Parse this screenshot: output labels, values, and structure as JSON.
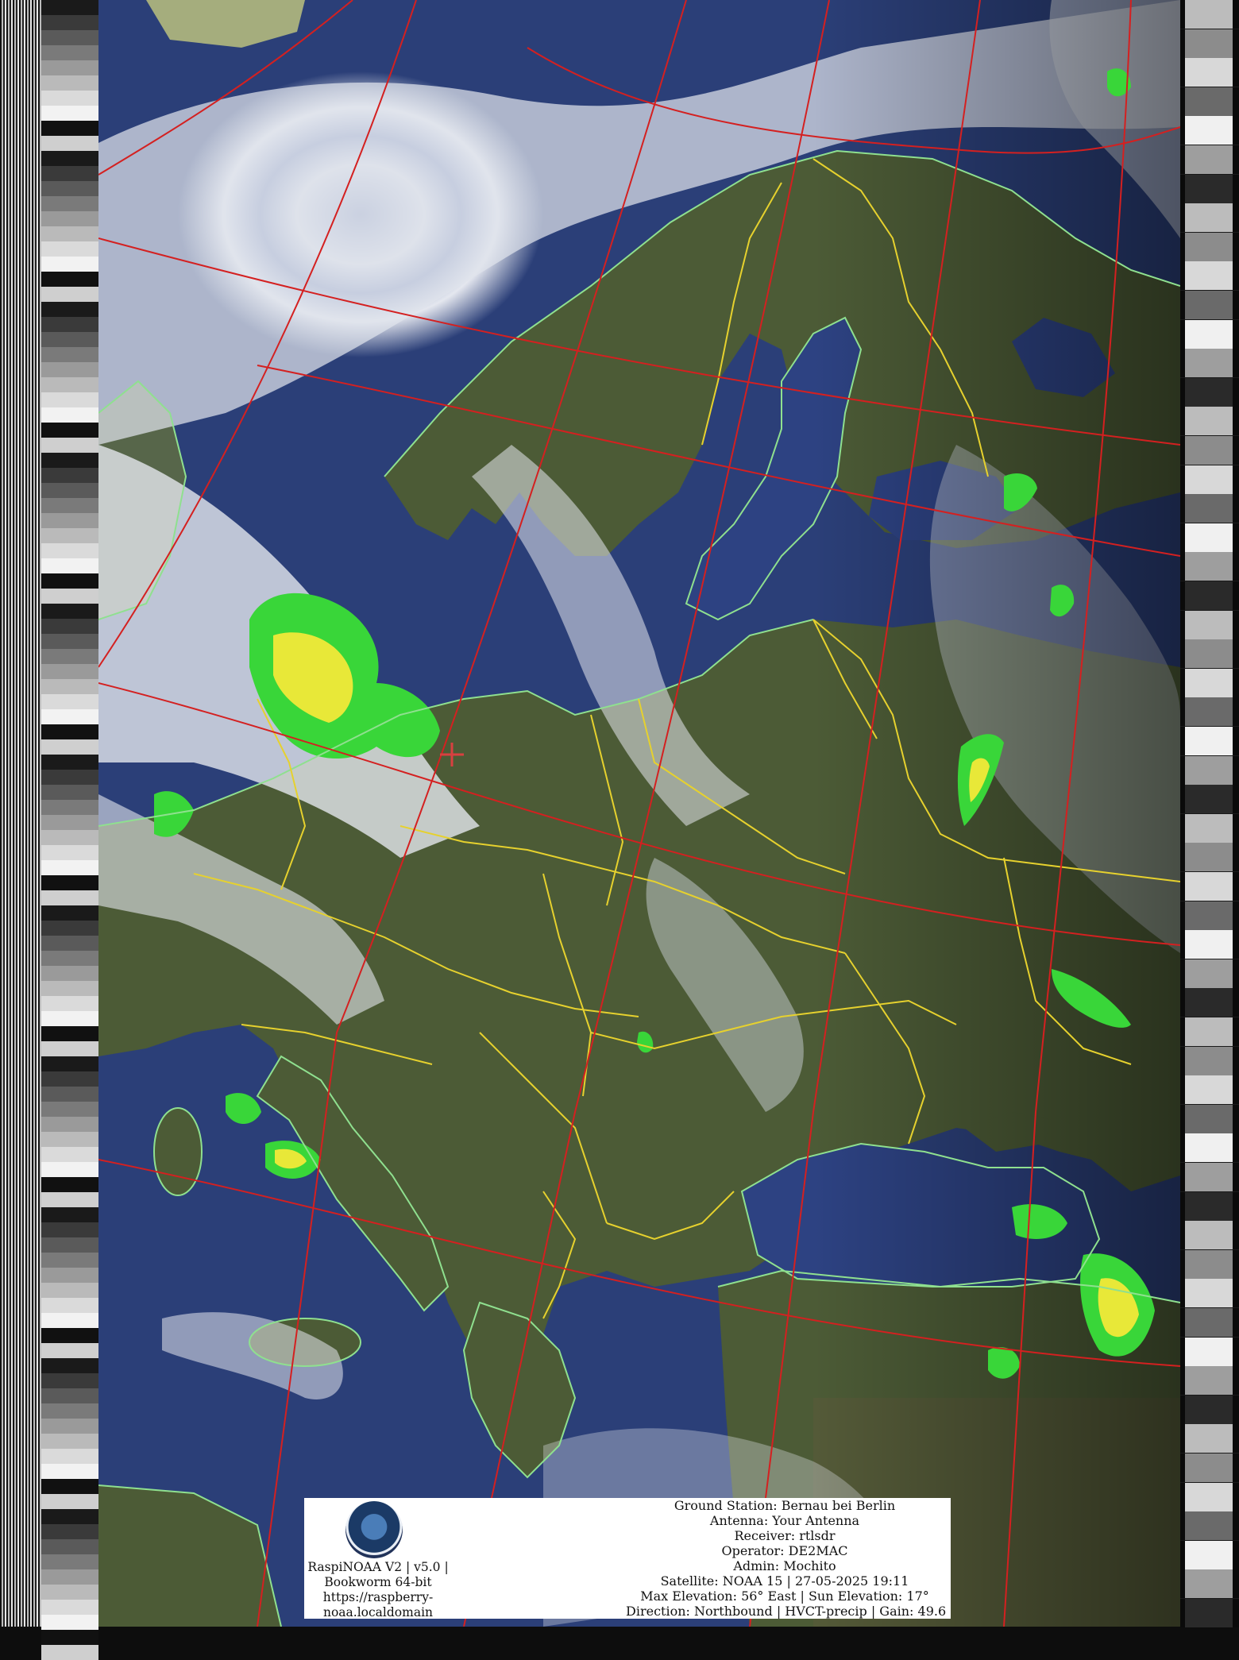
{
  "footer": {
    "software": {
      "line1": "RaspiNOAA V2 | v5.0 |",
      "line2": "Bookworm 64-bit",
      "line3": "https://raspberry-",
      "line4": "noaa.localdomain"
    },
    "station": {
      "ground_station": "Ground Station: Bernau bei Berlin",
      "antenna": "Antenna: Your Antenna",
      "receiver": "Receiver: rtlsdr",
      "operator": "Operator: DE2MAC",
      "admin": "Admin: Mochito",
      "satellite": "Satellite: NOAA 15 | 27-05-2025 19:11",
      "elevation": "Max Elevation: 56° East | Sun Elevation: 17°",
      "direction": "Direction: Northbound | HVCT-precip | Gain: 49.6"
    }
  },
  "colors": {
    "sea": "#2b3f78",
    "land": "#4a5a34",
    "cloud": "#d9dde6",
    "coastline": "#8fe08f",
    "borders": "#e6d12e",
    "graticule": "#d42020",
    "precip_light": "#39d639",
    "precip_heavy": "#e8e838"
  }
}
